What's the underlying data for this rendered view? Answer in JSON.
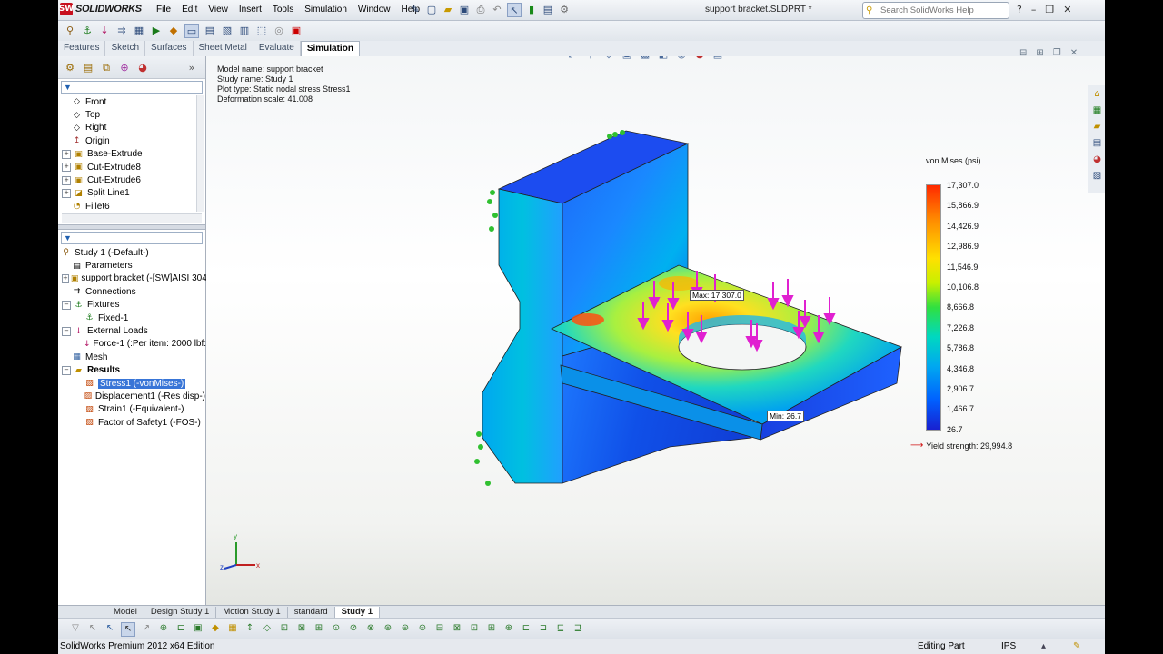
{
  "app": {
    "logo_text": "SOLIDWORKS",
    "logo_mark": "SW",
    "menu": [
      "File",
      "Edit",
      "View",
      "Insert",
      "Tools",
      "Simulation",
      "Window",
      "Help"
    ],
    "document_title": "support bracket.SLDPRT *",
    "search_placeholder": "Search SolidWorks Help"
  },
  "command_tabs": [
    "Features",
    "Sketch",
    "Surfaces",
    "Sheet Metal",
    "Evaluate",
    "Simulation"
  ],
  "active_command_tab": "Simulation",
  "feature_tree": [
    {
      "label": "Front",
      "icon": "plane-icon"
    },
    {
      "label": "Top",
      "icon": "plane-icon"
    },
    {
      "label": "Right",
      "icon": "plane-icon"
    },
    {
      "label": "Origin",
      "icon": "origin-icon"
    },
    {
      "label": "Base-Extrude",
      "icon": "extrude-icon"
    },
    {
      "label": "Cut-Extrude8",
      "icon": "cut-extrude-icon"
    },
    {
      "label": "Cut-Extrude6",
      "icon": "cut-extrude-icon"
    },
    {
      "label": "Split Line1",
      "icon": "split-line-icon"
    },
    {
      "label": "Fillet6",
      "icon": "fillet-icon"
    }
  ],
  "study_tree": {
    "root": "Study 1 (-Default-)",
    "items": [
      {
        "label": "Parameters",
        "level": 1
      },
      {
        "label": "support bracket (-[SW]AISI 304",
        "level": 1
      },
      {
        "label": "Connections",
        "level": 1
      },
      {
        "label": "Fixtures",
        "level": 1
      },
      {
        "label": "Fixed-1",
        "level": 2
      },
      {
        "label": "External Loads",
        "level": 1
      },
      {
        "label": "Force-1 (:Per item: 2000 lbf:",
        "level": 2
      },
      {
        "label": "Mesh",
        "level": 1
      },
      {
        "label": "Results",
        "level": 1
      },
      {
        "label": "Stress1 (-vonMises-)",
        "level": 2
      },
      {
        "label": "Displacement1 (-Res disp-)",
        "level": 2
      },
      {
        "label": "Strain1 (-Equivalent-)",
        "level": 2
      },
      {
        "label": "Factor of Safety1 (-FOS-)",
        "level": 2
      }
    ]
  },
  "model_info": {
    "model_name": "Model name: support bracket",
    "study_name": "Study name: Study 1",
    "plot_type": "Plot type: Static nodal stress Stress1",
    "deformation_scale": "Deformation scale: 41.008"
  },
  "legend": {
    "title": "von Mises (psi)",
    "values": [
      "17,307.0",
      "15,866.9",
      "14,426.9",
      "12,986.9",
      "11,546.9",
      "10,106.8",
      "8,666.8",
      "7,226.8",
      "5,786.8",
      "4,346.8",
      "2,906.7",
      "1,466.7",
      "26.7"
    ],
    "yield_strength": "Yield strength: 29,994.8"
  },
  "probes": {
    "max_label": "Max:",
    "max_value": "17,307.0",
    "min_label": "Min:",
    "min_value": "26.7"
  },
  "triad": {
    "x": "x",
    "y": "y",
    "z": "z"
  },
  "bottom_tabs": [
    "Model",
    "Design Study 1",
    "Motion Study 1",
    "standard",
    "Study 1"
  ],
  "active_bottom_tab": "Study 1",
  "status": {
    "edition": "SolidWorks Premium 2012 x64 Edition",
    "mode": "Editing Part",
    "units": "IPS"
  },
  "colors": {
    "load_arrow": "#e020d0",
    "fixture": "#30c030",
    "selection": "#3875d7"
  }
}
